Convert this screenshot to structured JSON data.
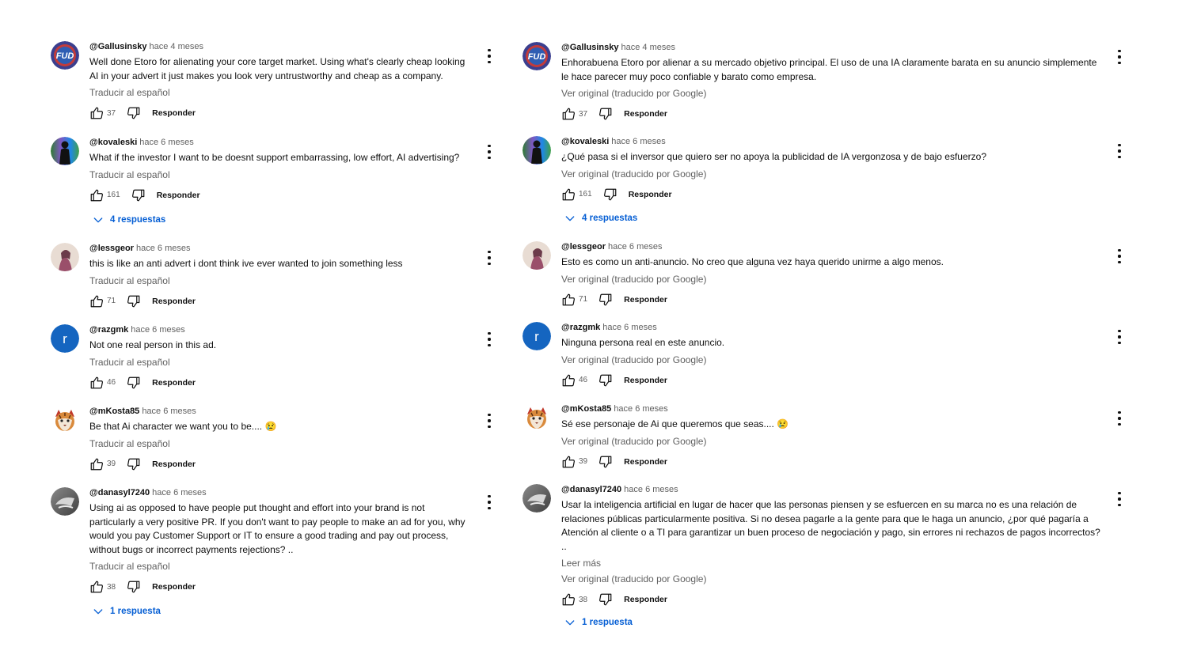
{
  "left": {
    "translate_label": "Traducir al español",
    "reply_label": "Responder",
    "comments": [
      {
        "author": "@Gallusinsky",
        "time": "hace 4 meses",
        "text": "Well done Etoro for alienating your core target market. Using what's clearly cheap looking AI in your advert it  just makes you look very untrustworthy and cheap as a company.",
        "likes": "37"
      },
      {
        "author": "@kovaleski",
        "time": "hace 6 meses",
        "text": "What if the investor I want to be doesnt support embarrassing, low effort, AI advertising?",
        "likes": "161",
        "replies": "4 respuestas"
      },
      {
        "author": "@lessgeor",
        "time": "hace 6 meses",
        "text": "this is like an anti advert i dont think ive ever wanted to join something less",
        "likes": "71"
      },
      {
        "author": "@razgmk",
        "time": "hace 6 meses",
        "text": "Not one real person in this ad.",
        "likes": "46",
        "avatar_letter": "r"
      },
      {
        "author": "@mKosta85",
        "time": "hace 6 meses",
        "text": "Be that Ai character we want you to be.... 😢",
        "likes": "39"
      },
      {
        "author": "@danasyl7240",
        "time": "hace 6 meses",
        "text": "Using ai as opposed to have people put thought and effort into your brand is not particularly a very positive PR. If you don't want to pay people to make an ad for you, why would you pay Customer Support or IT to ensure a good trading and pay out process, without bugs or incorrect payments rejections? ..",
        "likes": "38",
        "replies": "1 respuesta"
      }
    ]
  },
  "right": {
    "translate_label": "Ver original (traducido por Google)",
    "reply_label": "Responder",
    "readmore_label": "Leer más",
    "comments": [
      {
        "author": "@Gallusinsky",
        "time": "hace 4 meses",
        "text": "Enhorabuena Etoro por alienar a su mercado objetivo principal. El uso de una IA claramente barata en su anuncio simplemente le hace parecer muy poco confiable y barato como empresa.",
        "likes": "37"
      },
      {
        "author": "@kovaleski",
        "time": "hace 6 meses",
        "text": "¿Qué pasa si el inversor que quiero ser no apoya la publicidad de IA vergonzosa y de bajo esfuerzo?",
        "likes": "161",
        "replies": "4 respuestas"
      },
      {
        "author": "@lessgeor",
        "time": "hace 6 meses",
        "text": "Esto es como un anti-anuncio. No creo que alguna vez haya querido unirme a algo menos.",
        "likes": "71"
      },
      {
        "author": "@razgmk",
        "time": "hace 6 meses",
        "text": "Ninguna persona real en este anuncio.",
        "likes": "46",
        "avatar_letter": "r"
      },
      {
        "author": "@mKosta85",
        "time": "hace 6 meses",
        "text": "Sé ese personaje de Ai que queremos que seas.... 😢",
        "likes": "39"
      },
      {
        "author": "@danasyl7240",
        "time": "hace 6 meses",
        "text": "Usar la inteligencia artificial en lugar de hacer que las personas piensen y se esfuercen en su marca no es una relación de relaciones públicas particularmente positiva. Si no desea pagarle a la gente para que le haga un anuncio, ¿por qué pagaría a Atención al cliente o a TI para garantizar un buen proceso de negociación y pago, sin errores ni rechazos de pagos incorrectos? ..",
        "likes": "38",
        "replies": "1 respuesta",
        "read_more": true
      }
    ]
  },
  "colors": {
    "link": "#065fd4",
    "secondary_text": "#606060",
    "avatar_r": "#1565c0"
  },
  "icons": [
    "thumb-up-icon",
    "thumb-down-icon",
    "chevron-down-icon",
    "more-vert-icon"
  ]
}
